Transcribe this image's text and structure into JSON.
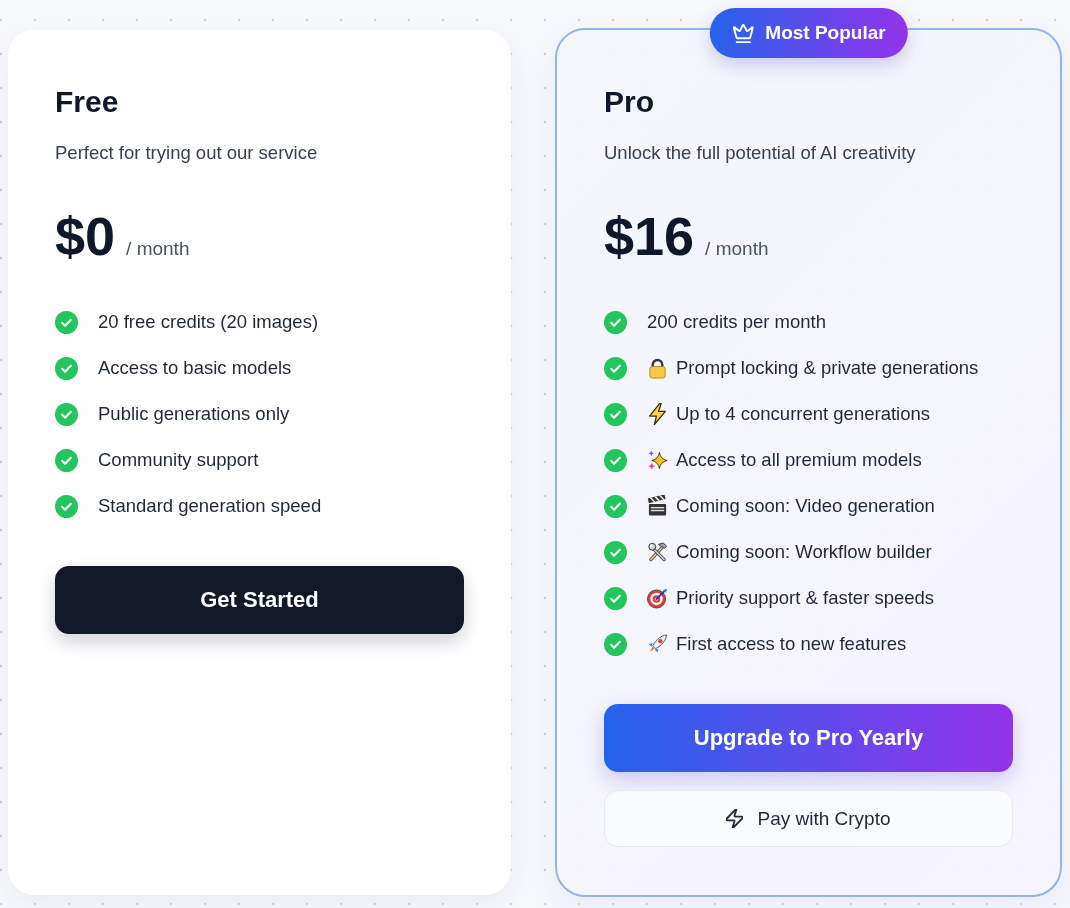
{
  "plans": [
    {
      "name": "Free",
      "description": "Perfect for trying out our service",
      "price": "$0",
      "period": "/ month",
      "highlighted": false,
      "features": [
        {
          "text": "20 free credits (20 images)",
          "kind": "plain"
        },
        {
          "text": "Access to basic models",
          "kind": "plain"
        },
        {
          "text": "Public generations only",
          "kind": "plain"
        },
        {
          "text": "Community support",
          "kind": "plain"
        },
        {
          "text": "Standard generation speed",
          "kind": "plain"
        }
      ],
      "buttons": [
        {
          "label": "Get Started",
          "kind": "solid"
        }
      ]
    },
    {
      "name": "Pro",
      "description": "Unlock the full potential of AI creativity",
      "price": "$16",
      "period": "/ month",
      "highlighted": true,
      "badge": {
        "label": "Most Popular"
      },
      "features": [
        {
          "text": "200 credits per month",
          "kind": "plain"
        },
        {
          "text": "Prompt locking & private generations",
          "kind": "lock"
        },
        {
          "text": "Up to 4 concurrent generations",
          "kind": "bolt"
        },
        {
          "text": "Access to all premium models",
          "kind": "sparkles"
        },
        {
          "text": "Coming soon: Video generation",
          "kind": "clapper"
        },
        {
          "text": "Coming soon: Workflow builder",
          "kind": "tools"
        },
        {
          "text": "Priority support & faster speeds",
          "kind": "target"
        },
        {
          "text": "First access to new features",
          "kind": "rocket"
        }
      ],
      "buttons": [
        {
          "label": "Upgrade to Pro Yearly",
          "kind": "gradient"
        },
        {
          "label": "Pay with Crypto",
          "kind": "secondary"
        }
      ]
    }
  ]
}
